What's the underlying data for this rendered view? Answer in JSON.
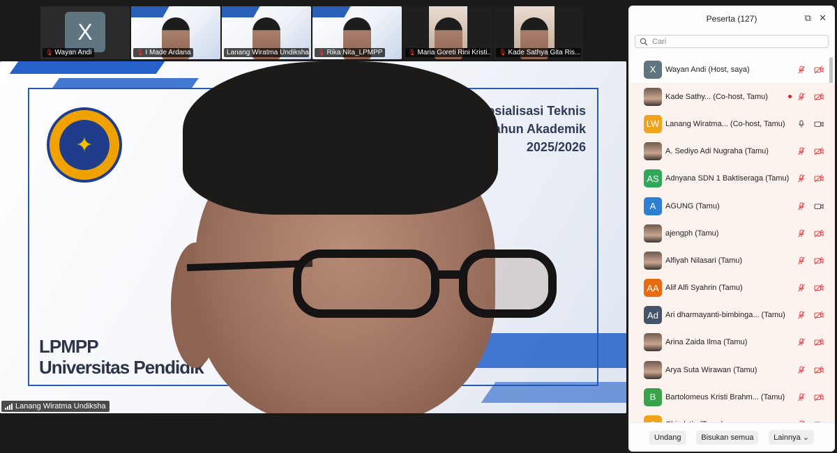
{
  "thumbnails": [
    {
      "name": "Wayan Andi",
      "muted": true,
      "kind": "avatar",
      "avatar_letter": "X",
      "active": false
    },
    {
      "name": "I Made Ardana",
      "muted": true,
      "kind": "video",
      "active": false
    },
    {
      "name": "Lanang Wiratma Undiksha",
      "muted": false,
      "kind": "video",
      "active": true
    },
    {
      "name": "Rika Nita_LPMPP",
      "muted": true,
      "kind": "video",
      "active": false
    },
    {
      "name": "Maria Goreti Rini Kristi...",
      "muted": true,
      "kind": "video",
      "active": false
    },
    {
      "name": "Kade Sathya Gita Ris...",
      "muted": true,
      "kind": "video",
      "active": false
    }
  ],
  "main_video": {
    "speaker_label": "Lanang Wiratma Undiksha",
    "slide_title_lines": [
      "osialisasi Teknis",
      "ahun Akademik",
      "2025/2026"
    ],
    "slide_left_lines": [
      "LPMPP",
      "Universitas Pendidik"
    ]
  },
  "panel": {
    "title": "Peserta (127)",
    "search_placeholder": "Cari",
    "footer": {
      "invite": "Undang",
      "mute_all": "Bisukan semua",
      "more": "Lainnya"
    }
  },
  "participants": [
    {
      "name": "Wayan Andi (Host, saya)",
      "avatar": "X",
      "color": "#5f7680",
      "mic": "muted",
      "video": "off",
      "highlight": false
    },
    {
      "name": "Kade Sathy...   (Co-host, Tamu)",
      "avatar": "",
      "color": "photo",
      "mic": "muted",
      "video": "off",
      "highlight": true,
      "recording": true
    },
    {
      "name": "Lanang Wiratma...   (Co-host, Tamu)",
      "avatar": "LW",
      "color": "#f0a41b",
      "mic": "on",
      "video": "on",
      "highlight": true
    },
    {
      "name": "A. Sediyo Adi Nugraha (Tamu)",
      "avatar": "",
      "color": "photo",
      "mic": "muted",
      "video": "off",
      "highlight": true
    },
    {
      "name": "Adnyana SDN 1 Baktiseraga  (Tamu)",
      "avatar": "AS",
      "color": "#2fa85a",
      "mic": "muted",
      "video": "off",
      "highlight": true
    },
    {
      "name": "AGUNG (Tamu)",
      "avatar": "A",
      "color": "#2d7fd4",
      "mic": "muted",
      "video": "on",
      "highlight": true
    },
    {
      "name": "ajengph (Tamu)",
      "avatar": "",
      "color": "photo",
      "mic": "muted",
      "video": "off",
      "highlight": true
    },
    {
      "name": "Alfiyah Nilasari (Tamu)",
      "avatar": "",
      "color": "photo",
      "mic": "muted",
      "video": "off",
      "highlight": true
    },
    {
      "name": "Alif Alfi Syahrin (Tamu)",
      "avatar": "AA",
      "color": "#e66b12",
      "mic": "muted",
      "video": "off",
      "highlight": true
    },
    {
      "name": "Ari dharmayanti-bimbinga...  (Tamu)",
      "avatar": "Ad",
      "color": "#44546a",
      "mic": "muted",
      "video": "off",
      "highlight": true
    },
    {
      "name": "Arina Zaida Ilma (Tamu)",
      "avatar": "",
      "color": "photo",
      "mic": "muted",
      "video": "off",
      "highlight": true
    },
    {
      "name": "Arya Suta Wirawan (Tamu)",
      "avatar": "",
      "color": "photo",
      "mic": "muted",
      "video": "off",
      "highlight": true
    },
    {
      "name": "Bartolomeus Kristi Brahm...  (Tamu)",
      "avatar": "B",
      "color": "#3aa34a",
      "mic": "muted",
      "video": "off",
      "highlight": true
    },
    {
      "name": "Chindytia (Tamu)",
      "avatar": "C",
      "color": "#f0a41b",
      "mic": "muted",
      "video": "on",
      "highlight": true
    }
  ]
}
